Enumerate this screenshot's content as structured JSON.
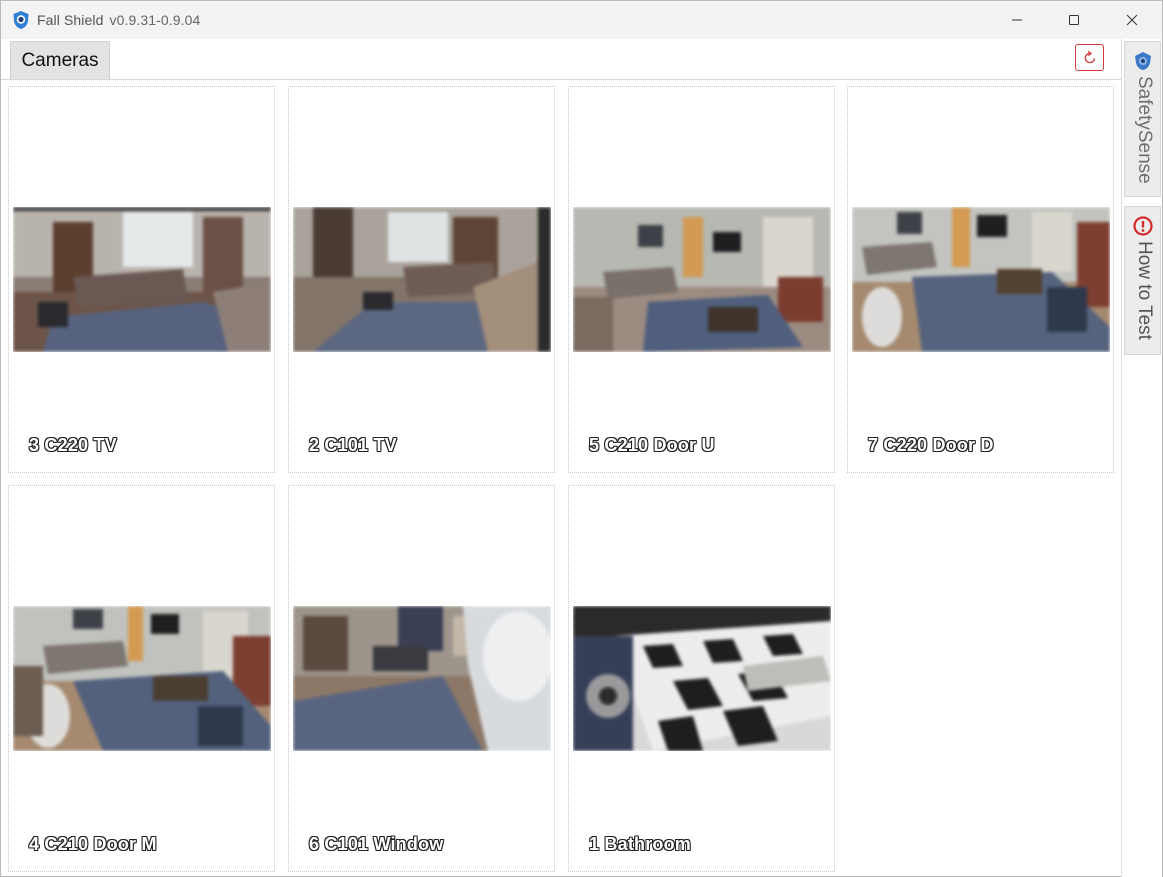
{
  "window": {
    "app_name": "Fall Shield",
    "version": "v0.9.31-0.9.04"
  },
  "tabs": {
    "cameras_label": "Cameras"
  },
  "sidebar": {
    "safety_label": "SafetySense",
    "howto_label": "How to Test"
  },
  "cameras": [
    {
      "label": "3 C220 TV",
      "scene": "living-room-sofa"
    },
    {
      "label": "2 C101 TV",
      "scene": "living-room-fisheye"
    },
    {
      "label": "5 C210 Door U",
      "scene": "living-room-wide"
    },
    {
      "label": "7 C220 Door D",
      "scene": "living-room-rug"
    },
    {
      "label": "4 C210 Door M",
      "scene": "living-room-wide"
    },
    {
      "label": "6 C101 Window",
      "scene": "living-room-bright"
    },
    {
      "label": "1 Bathroom",
      "scene": "checker-floor"
    }
  ],
  "colors": {
    "accent_red": "#d43b3b",
    "brand_blue": "#2f7fd6"
  }
}
